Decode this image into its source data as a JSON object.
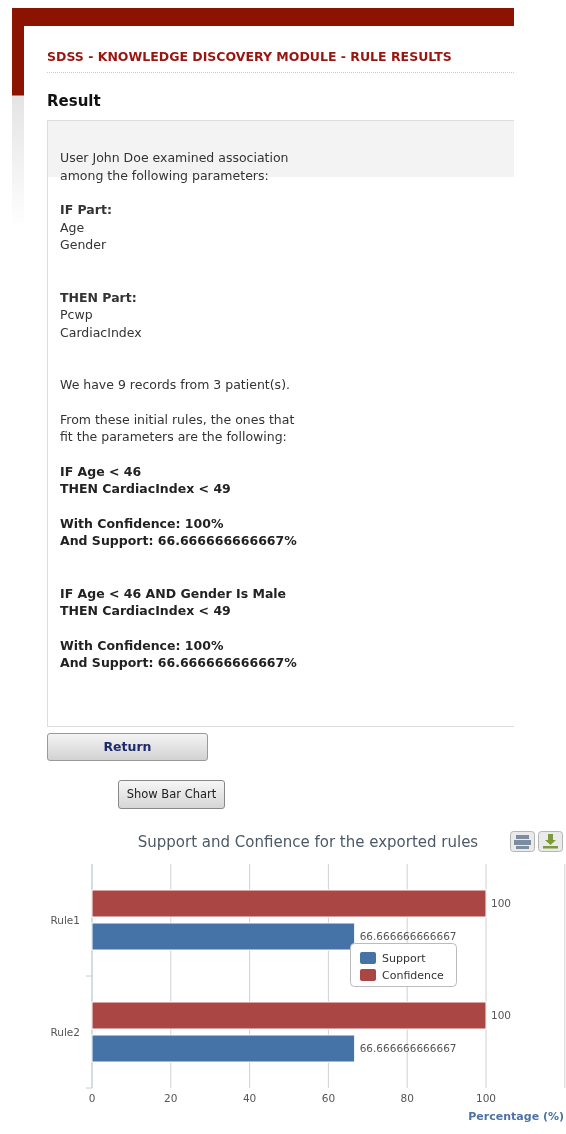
{
  "page_title": "SDSS - KNOWLEDGE DISCOVERY MODULE - RULE RESULTS",
  "section_title": "Result",
  "result": {
    "blocks": [
      {
        "kind": "text",
        "text": "User John Doe examined association\namong the following parameters:"
      },
      {
        "kind": "list",
        "heading": "IF Part:",
        "items": [
          "Age",
          "Gender"
        ]
      },
      {
        "kind": "list",
        "heading": "THEN Part:",
        "items": [
          "Pcwp",
          "CardiacIndex"
        ]
      },
      {
        "kind": "text",
        "text": "We have 9 records from 3 patient(s)."
      },
      {
        "kind": "text",
        "text": "From these initial rules, the ones that\nfit the parameters are the following:"
      },
      {
        "kind": "condition",
        "text": "IF Age < 46\nTHEN CardiacIndex < 49"
      },
      {
        "kind": "measure",
        "text": "With Confidence: 100%\nAnd Support: 66.666666666667%"
      },
      {
        "kind": "condition",
        "text": "IF Age < 46 AND Gender Is Male\nTHEN CardiacIndex < 49"
      },
      {
        "kind": "measure",
        "text": "With Confidence: 100%\nAnd Support: 66.666666666667%"
      }
    ]
  },
  "buttons": {
    "return": "Return",
    "show_chart": "Show Bar Chart"
  },
  "chart": {
    "chart_data": {
      "type": "bar",
      "orientation": "horizontal",
      "title": "Support and Confience for the exported rules",
      "xlabel": "Percentage (%)",
      "categories": [
        "Rule1",
        "Rule2"
      ],
      "series": [
        {
          "name": "Support",
          "color": "#4572a7",
          "values": [
            66.666666666667,
            66.666666666667
          ]
        },
        {
          "name": "Confidence",
          "color": "#aa4643",
          "values": [
            100,
            100
          ]
        }
      ],
      "xticks": [
        0,
        20,
        40,
        60,
        80,
        100
      ],
      "xlim": [
        0,
        120
      ],
      "grid": true,
      "legend": true,
      "data_labels": true
    }
  }
}
